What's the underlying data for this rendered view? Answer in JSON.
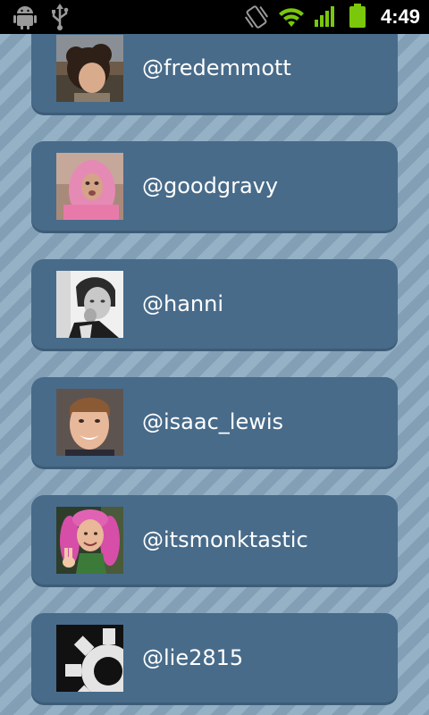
{
  "status_bar": {
    "time": "4:49",
    "icons": [
      "android-debug-icon",
      "usb-icon",
      "vibrate-icon",
      "wifi-icon",
      "signal-icon",
      "battery-icon"
    ]
  },
  "users": [
    {
      "handle": "@fredemmott",
      "avatar": "avatar-photo-curly-hair"
    },
    {
      "handle": "@goodgravy",
      "avatar": "avatar-photo-pink-hood"
    },
    {
      "handle": "@hanni",
      "avatar": "avatar-photo-black-white"
    },
    {
      "handle": "@isaac_lewis",
      "avatar": "avatar-photo-smiling"
    },
    {
      "handle": "@itsmonktastic",
      "avatar": "avatar-photo-pink-wig"
    },
    {
      "handle": "@lie2815",
      "avatar": "avatar-default-gear"
    }
  ],
  "colors": {
    "card": "#486b8a",
    "background_stripe_light": "#95b1c6",
    "background_stripe_dark": "#829fb6",
    "status_bar": "#000000",
    "battery_green": "#7ac70c"
  }
}
